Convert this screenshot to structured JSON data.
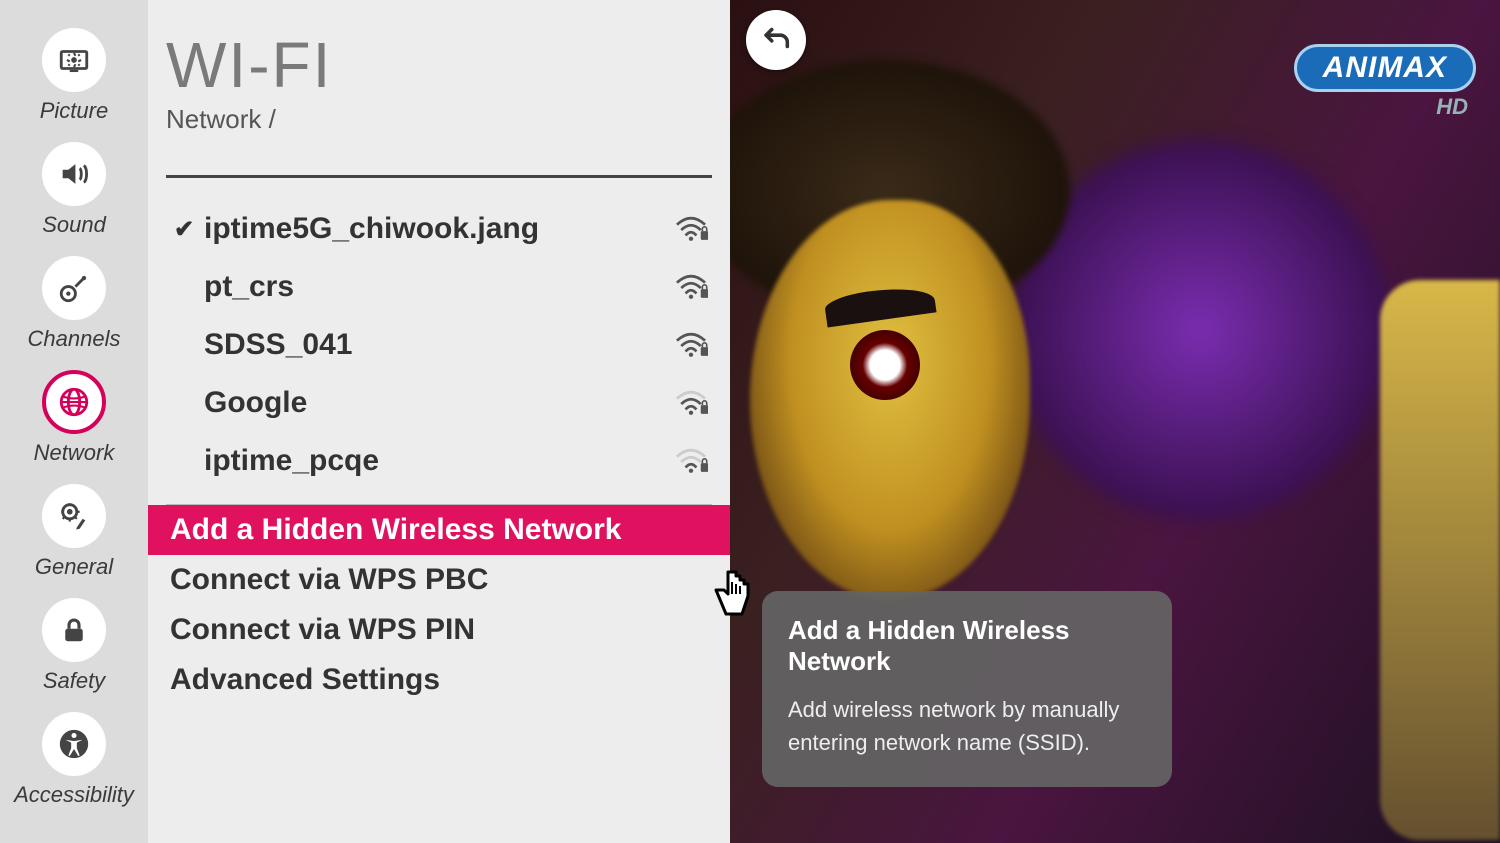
{
  "sidebar": {
    "items": [
      {
        "id": "picture",
        "label": "Picture"
      },
      {
        "id": "sound",
        "label": "Sound"
      },
      {
        "id": "channels",
        "label": "Channels"
      },
      {
        "id": "network",
        "label": "Network",
        "active": true
      },
      {
        "id": "general",
        "label": "General"
      },
      {
        "id": "safety",
        "label": "Safety"
      },
      {
        "id": "accessibility",
        "label": "Accessibility"
      }
    ]
  },
  "panel": {
    "title": "WI-FI",
    "breadcrumb": "Network /",
    "networks": [
      {
        "ssid": "iptime5G_chiwook.jang",
        "connected": true,
        "secured": true,
        "strength": 3
      },
      {
        "ssid": "pt_crs",
        "connected": false,
        "secured": true,
        "strength": 3
      },
      {
        "ssid": "SDSS_041",
        "connected": false,
        "secured": true,
        "strength": 3
      },
      {
        "ssid": "Google",
        "connected": false,
        "secured": true,
        "strength": 2
      },
      {
        "ssid": "iptime_pcqe",
        "connected": false,
        "secured": true,
        "strength": 1
      }
    ],
    "options": [
      {
        "label": "Add a Hidden Wireless Network",
        "highlighted": true
      },
      {
        "label": "Connect via WPS PBC",
        "highlighted": false
      },
      {
        "label": "Connect via WPS PIN",
        "highlighted": false
      },
      {
        "label": "Advanced Settings",
        "highlighted": false
      }
    ]
  },
  "tooltip": {
    "title": "Add a Hidden Wireless Network",
    "body": "Add wireless network by manually entering network name (SSID)."
  },
  "channel": {
    "name": "ANIMAX",
    "quality": "HD"
  },
  "icons": {
    "back": "back-arrow-icon"
  }
}
